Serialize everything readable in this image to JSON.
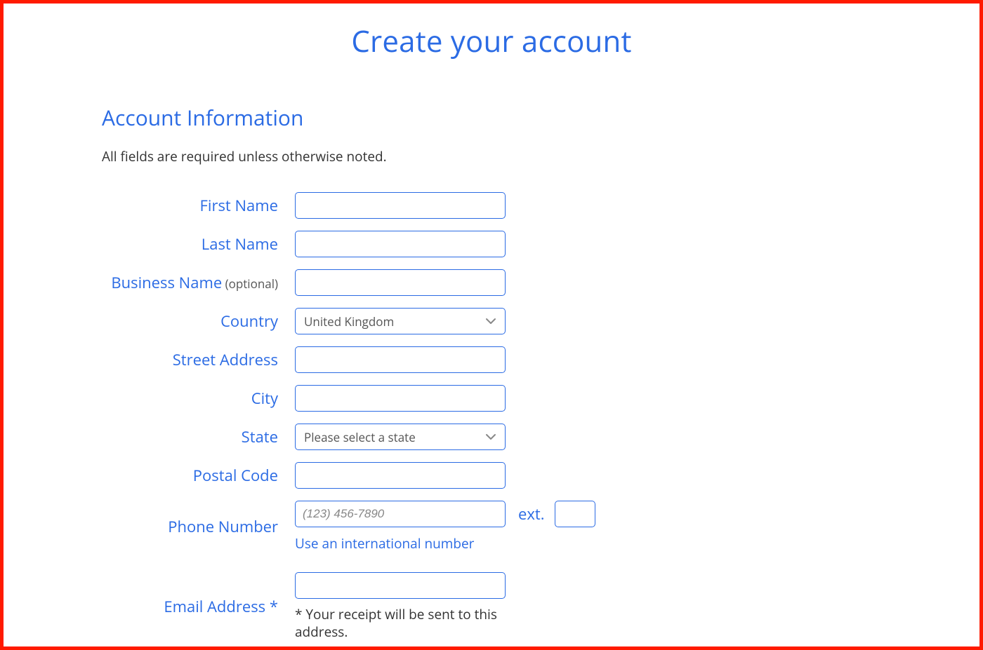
{
  "page": {
    "title": "Create your account"
  },
  "section": {
    "title": "Account Information",
    "required_note": "All fields are required unless otherwise noted."
  },
  "labels": {
    "first_name": "First Name",
    "last_name": "Last Name",
    "business_name": "Business Name",
    "business_optional": " (optional)",
    "country": "Country",
    "street_address": "Street Address",
    "city": "City",
    "state": "State",
    "postal_code": "Postal Code",
    "phone_number": "Phone Number",
    "ext": "ext.",
    "email_address": "Email Address *"
  },
  "selects": {
    "country_value": "United Kingdom",
    "state_value": "Please select a state"
  },
  "placeholders": {
    "phone": "(123) 456-7890"
  },
  "helpers": {
    "intl_link": "Use an international number",
    "email_note": "* Your receipt will be sent to this address."
  }
}
